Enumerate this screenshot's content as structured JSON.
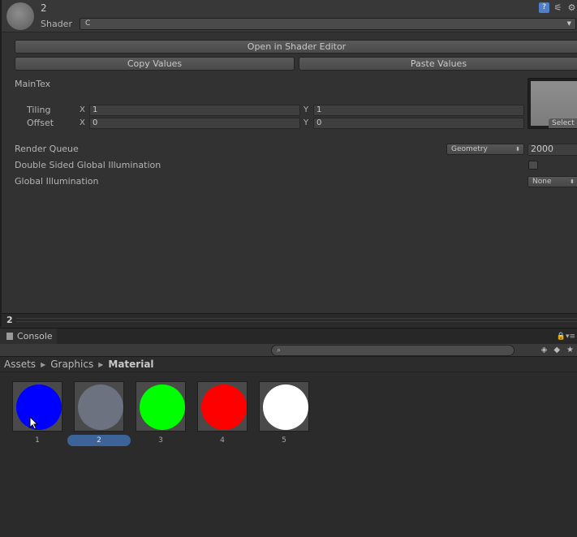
{
  "inspector": {
    "material_name": "2",
    "shader_label": "Shader",
    "shader_value": "C",
    "open_shader_editor": "Open in Shader Editor",
    "copy_values": "Copy Values",
    "paste_values": "Paste Values",
    "maintex_label": "MainTex",
    "tiling_label": "Tiling",
    "offset_label": "Offset",
    "x_axis": "X",
    "y_axis": "Y",
    "tiling_x": "1",
    "tiling_y": "1",
    "offset_x": "0",
    "offset_y": "0",
    "texture_select": "Select",
    "render_queue_label": "Render Queue",
    "render_queue_mode": "Geometry",
    "render_queue_value": "2000",
    "double_sided_label": "Double Sided Global Illumination",
    "double_sided_checked": false,
    "gi_label": "Global Illumination",
    "gi_value": "None",
    "preview_name": "2"
  },
  "console_tab": {
    "label": "Console"
  },
  "breadcrumb": {
    "assets": "Assets",
    "graphics": "Graphics",
    "material": "Material"
  },
  "assets": [
    {
      "name": "1",
      "color": "#0000ff"
    },
    {
      "name": "2",
      "color": "#6c7280",
      "selected": true
    },
    {
      "name": "3",
      "color": "#00ff00"
    },
    {
      "name": "4",
      "color": "#ff0000"
    },
    {
      "name": "5",
      "color": "#ffffff"
    }
  ]
}
